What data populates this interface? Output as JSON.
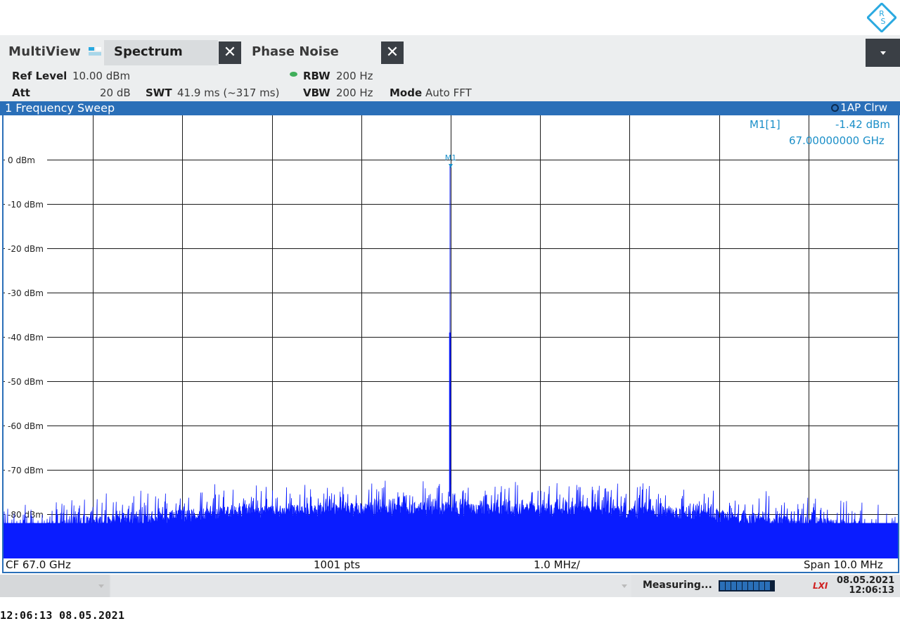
{
  "tabs": {
    "multiview_label": "MultiView",
    "spectrum_label": "Spectrum",
    "phase_noise_label": "Phase Noise"
  },
  "settings": {
    "ref_level_label": "Ref Level",
    "ref_level_value": "10.00 dBm",
    "att_label": "Att",
    "att_value": "20 dB",
    "swt_label": "SWT",
    "swt_value": "41.9 ms (~317 ms)",
    "rbw_label": "RBW",
    "rbw_value": "200 Hz",
    "vbw_label": "VBW",
    "vbw_value": "200 Hz",
    "mode_label": "Mode",
    "mode_value": "Auto FFT"
  },
  "window": {
    "title": "1 Frequency Sweep",
    "trace_label": "1AP Clrw"
  },
  "marker": {
    "name": "M1[1]",
    "level": "-1.42 dBm",
    "frequency": "67.00000000 GHz",
    "plot_label": "M1"
  },
  "infoline": {
    "cf": "CF 67.0 GHz",
    "points": "1001 pts",
    "div": "1.0 MHz/",
    "span": "Span 10.0 MHz"
  },
  "status": {
    "measuring": "Measuring...",
    "lxi": "LXI",
    "date": "08.05.2021",
    "time": "12:06:13"
  },
  "footer": {
    "timestamp": "12:06:13   08.05.2021"
  },
  "colors": {
    "accent": "#2a6fb8",
    "trace": "#0a1cff",
    "marker": "#1b8fc8"
  },
  "chart_data": {
    "type": "line",
    "ylim": [
      -90,
      10
    ],
    "xlim": [
      -5,
      5
    ],
    "yticks": [
      "0 dBm",
      "-10 dBm",
      "-20 dBm",
      "-30 dBm",
      "-40 dBm",
      "-50 dBm",
      "-60 dBm",
      "-70 dBm",
      "-80 dBm"
    ],
    "ytick_values": [
      0,
      -10,
      -20,
      -30,
      -40,
      -50,
      -60,
      -70,
      -80
    ],
    "grid": true,
    "series": [
      {
        "x": [
          -5,
          -4,
          -3,
          -2,
          -1,
          -0.05,
          0,
          0.05,
          1,
          2,
          3,
          4,
          5
        ],
        "values": [
          -81,
          -79,
          -77.5,
          -76.5,
          -76,
          -76,
          -1.42,
          -76,
          -76,
          -76.5,
          -77.5,
          -79,
          -81
        ]
      }
    ],
    "peak": {
      "x": 0,
      "y": -1.42
    },
    "secondary_level": -39
  }
}
